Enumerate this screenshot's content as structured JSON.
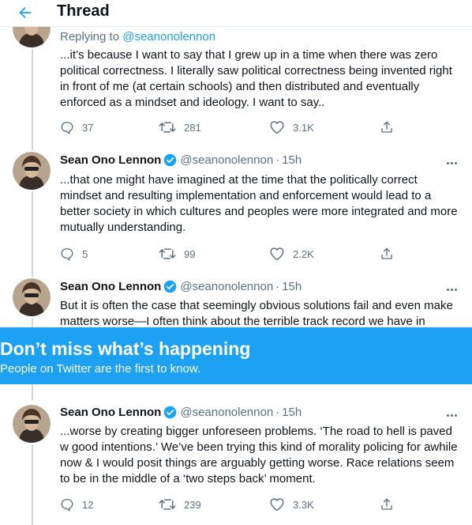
{
  "header": {
    "title": "Thread"
  },
  "tweets": [
    {
      "replying_prefix": "Replying to",
      "replying_handle": "@seanonolennon",
      "text": "...it’s because I want to say that I grew up in a time when there was zero political correctness. I literally saw political correctness being invented right in front of me (at certain schools) and then distributed and eventually enforced as a mindset and ideology. I want to say..",
      "replies": "37",
      "retweets": "281",
      "likes": "3.1K"
    },
    {
      "name": "Sean Ono Lennon",
      "handle": "@seanonolennon",
      "separator": "·",
      "time": "15h",
      "text": "...that one might have imagined at the time that the politically correct mindset and resulting implementation and enforcement would lead to a better society in which cultures and peoples were more integrated and more mutually understanding.",
      "replies": "5",
      "retweets": "99",
      "likes": "2.2K"
    },
    {
      "name": "Sean Ono Lennon",
      "handle": "@seanonolennon",
      "separator": "·",
      "time": "15h",
      "text": "But it is often the case that seemingly obvious solutions fail and even make matters worse—I often think about the terrible track record we have in"
    },
    {
      "name": "Sean Ono Lennon",
      "handle": "@seanonolennon",
      "separator": "·",
      "time": "15h",
      "text": "...worse by creating bigger unforeseen problems. ‘The road to hell is paved w good intentions.’ We’ve been trying this kind of morality policing for awhile now & I would posit things are arguably getting worse. Race relations seem to be in the middle of a ‘two steps back’ moment.",
      "replies": "12",
      "retweets": "239",
      "likes": "3.3K"
    }
  ],
  "cta": {
    "title": "Don’t miss what’s happening",
    "subtitle": "People on Twitter are the first to know."
  },
  "colors": {
    "accent": "#1da1f2",
    "secondary_text": "#5b7083",
    "divider": "#e6ecf0"
  },
  "icons": [
    "arrow-left-icon",
    "verified-badge-icon",
    "more-icon",
    "reply-icon",
    "retweet-icon",
    "like-icon",
    "share-icon"
  ]
}
